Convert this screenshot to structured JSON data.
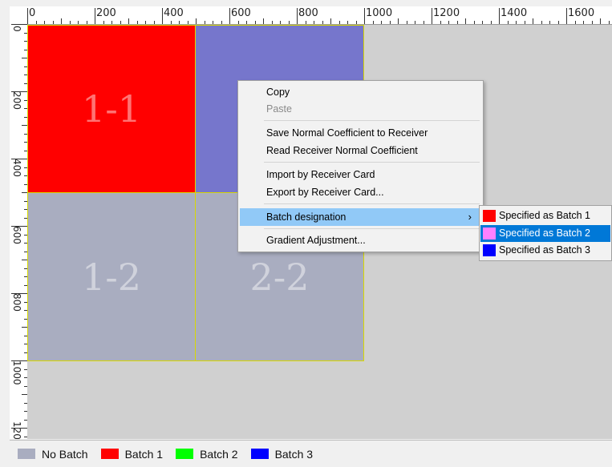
{
  "ruler": {
    "top_labels": [
      "0",
      "200",
      "400",
      "600",
      "800",
      "1000",
      "1200",
      "1400",
      "1600"
    ],
    "left_labels": [
      "0",
      "200",
      "400",
      "600",
      "800",
      "1000",
      "120"
    ]
  },
  "cells": [
    {
      "label": "1-1",
      "color": "#ff0000"
    },
    {
      "label": "",
      "color": "#7676cc"
    },
    {
      "label": "1-2",
      "color": "#a9adc0"
    },
    {
      "label": "2-2",
      "color": "#a9adc0"
    }
  ],
  "context_menu": {
    "copy": "Copy",
    "paste": "Paste",
    "save_normal": "Save Normal Coefficient to Receiver",
    "read_normal": "Read Receiver Normal Coefficient",
    "import_card": "Import by Receiver Card",
    "export_card": "Export by Receiver Card...",
    "batch_designation": "Batch designation",
    "gradient": "Gradient Adjustment...",
    "chevron": "›"
  },
  "submenu": {
    "items": [
      {
        "label": "Specified as Batch 1",
        "color": "#ff0000"
      },
      {
        "label": "Specified as Batch 2",
        "color": "#ff80ff"
      },
      {
        "label": "Specified as Batch 3",
        "color": "#0000ff"
      }
    ]
  },
  "legend": {
    "items": [
      {
        "label": "No Batch",
        "color": "#a9adc0"
      },
      {
        "label": "Batch 1",
        "color": "#ff0000"
      },
      {
        "label": "Batch 2",
        "color": "#00ff00"
      },
      {
        "label": "Batch 3",
        "color": "#0000ff"
      }
    ]
  }
}
